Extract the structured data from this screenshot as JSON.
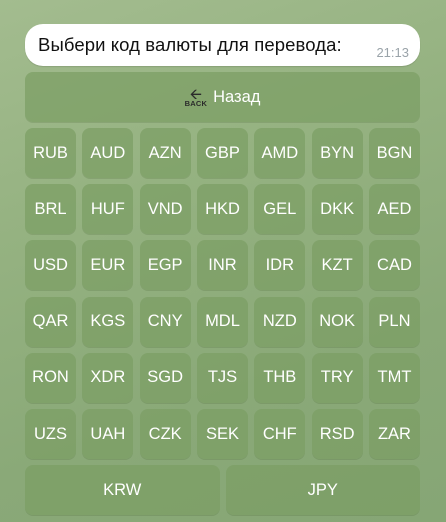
{
  "message": {
    "text": "Выбери код валюты для перевода:",
    "time": "21:13"
  },
  "keyboard": {
    "back": {
      "icon": "back-arrow-icon",
      "icon_text": "BACK",
      "label": "Назад"
    },
    "rows": [
      [
        "RUB",
        "AUD",
        "AZN",
        "GBP",
        "AMD",
        "BYN",
        "BGN"
      ],
      [
        "BRL",
        "HUF",
        "VND",
        "HKD",
        "GEL",
        "DKK",
        "AED"
      ],
      [
        "USD",
        "EUR",
        "EGP",
        "INR",
        "IDR",
        "KZT",
        "CAD"
      ],
      [
        "QAR",
        "KGS",
        "CNY",
        "MDL",
        "NZD",
        "NOK",
        "PLN"
      ],
      [
        "RON",
        "XDR",
        "SGD",
        "TJS",
        "THB",
        "TRY",
        "TMT"
      ],
      [
        "UZS",
        "UAH",
        "CZK",
        "SEK",
        "CHF",
        "RSD",
        "ZAR"
      ]
    ],
    "last_row": [
      "KRW",
      "JPY"
    ]
  }
}
